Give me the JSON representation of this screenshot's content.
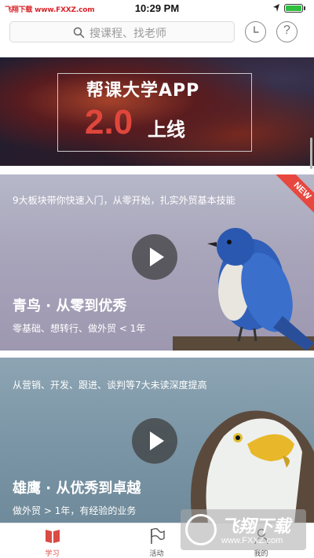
{
  "status_bar": {
    "watermark": "飞翔下载 www.FXXZ.com",
    "time": "10:29 PM",
    "battery_color": "#2fbf3f"
  },
  "header": {
    "search_placeholder": "搜课程、找老师",
    "history_icon": "clock-icon",
    "help_label": "?"
  },
  "banner": {
    "line1": "帮课大学APP",
    "version": "2.0",
    "line2": "上线"
  },
  "courses": [
    {
      "description": "9大板块带你快速入门，从零开始，扎实外贸基本技能",
      "title": "青鸟 · 从零到优秀",
      "subtitle": "零基础、想转行、做外贸 < 1年",
      "badge": "NEW",
      "image": "blue-bird"
    },
    {
      "description": "从营销、开发、跟进、谈判等7大未读深度提高",
      "title": "雄鹰 · 从优秀到卓越",
      "subtitle": "做外贸 > 1年，有经验的业务",
      "image": "eagle"
    }
  ],
  "tabs": [
    {
      "label": "学习",
      "icon": "book-icon",
      "active": true
    },
    {
      "label": "活动",
      "icon": "flag-icon",
      "active": false
    },
    {
      "label": "我的",
      "icon": "person-icon",
      "active": false
    }
  ],
  "watermark_logo": {
    "text": "飞翔下载",
    "url": "www.FXXZ.com"
  },
  "colors": {
    "accent": "#d94b44",
    "badge": "#e8473f"
  }
}
